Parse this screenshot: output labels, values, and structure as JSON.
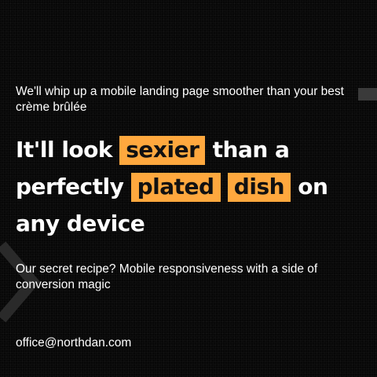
{
  "hero": {
    "subtitle": "We'll whip up a mobile landing page smoother than your best crème brûlée",
    "headline": {
      "part1": "It'll look ",
      "highlight1": "sexier",
      "part2": " than a perfectly ",
      "highlight2": "plated",
      "highlight3": "dish",
      "part3": " on any device"
    },
    "description": "Our secret recipe? Mobile responsiveness with a side of conversion magic"
  },
  "contact": {
    "email": "office@northdan.com"
  },
  "colors": {
    "background": "#070707",
    "accent": "#ffa83e",
    "text": "#ffffff"
  },
  "icons": {
    "decor_left": "chevron-right-icon",
    "decor_right": "bar-decoration"
  }
}
